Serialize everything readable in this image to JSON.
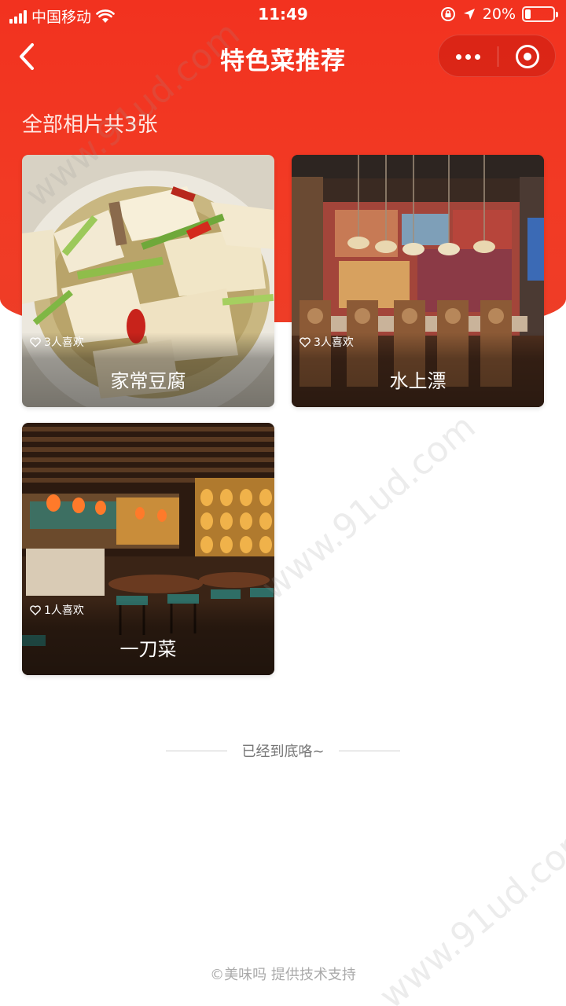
{
  "status_bar": {
    "carrier": "中国移动",
    "time": "11:49",
    "battery": "20%",
    "battery_level": 0.2,
    "icons": [
      "signal-icon",
      "wifi-icon",
      "lock-rotation-icon",
      "location-icon",
      "battery-icon"
    ]
  },
  "nav": {
    "title": "特色菜推荐",
    "icons": [
      "back-arrow-icon",
      "more-dots-icon",
      "close-target-icon"
    ]
  },
  "gallery": {
    "count_text": "全部相片共3张",
    "items": [
      {
        "name": "家常豆腐",
        "likes": "3人喜欢"
      },
      {
        "name": "水上漂",
        "likes": "3人喜欢"
      },
      {
        "name": "一刀菜",
        "likes": "1人喜欢"
      }
    ]
  },
  "end_text": "已经到底咯~",
  "footer": "©美味吗 提供技术支持",
  "watermark": "www.91ud.com",
  "colors": {
    "header_red": "#f2321f",
    "text_gray": "#777777"
  }
}
